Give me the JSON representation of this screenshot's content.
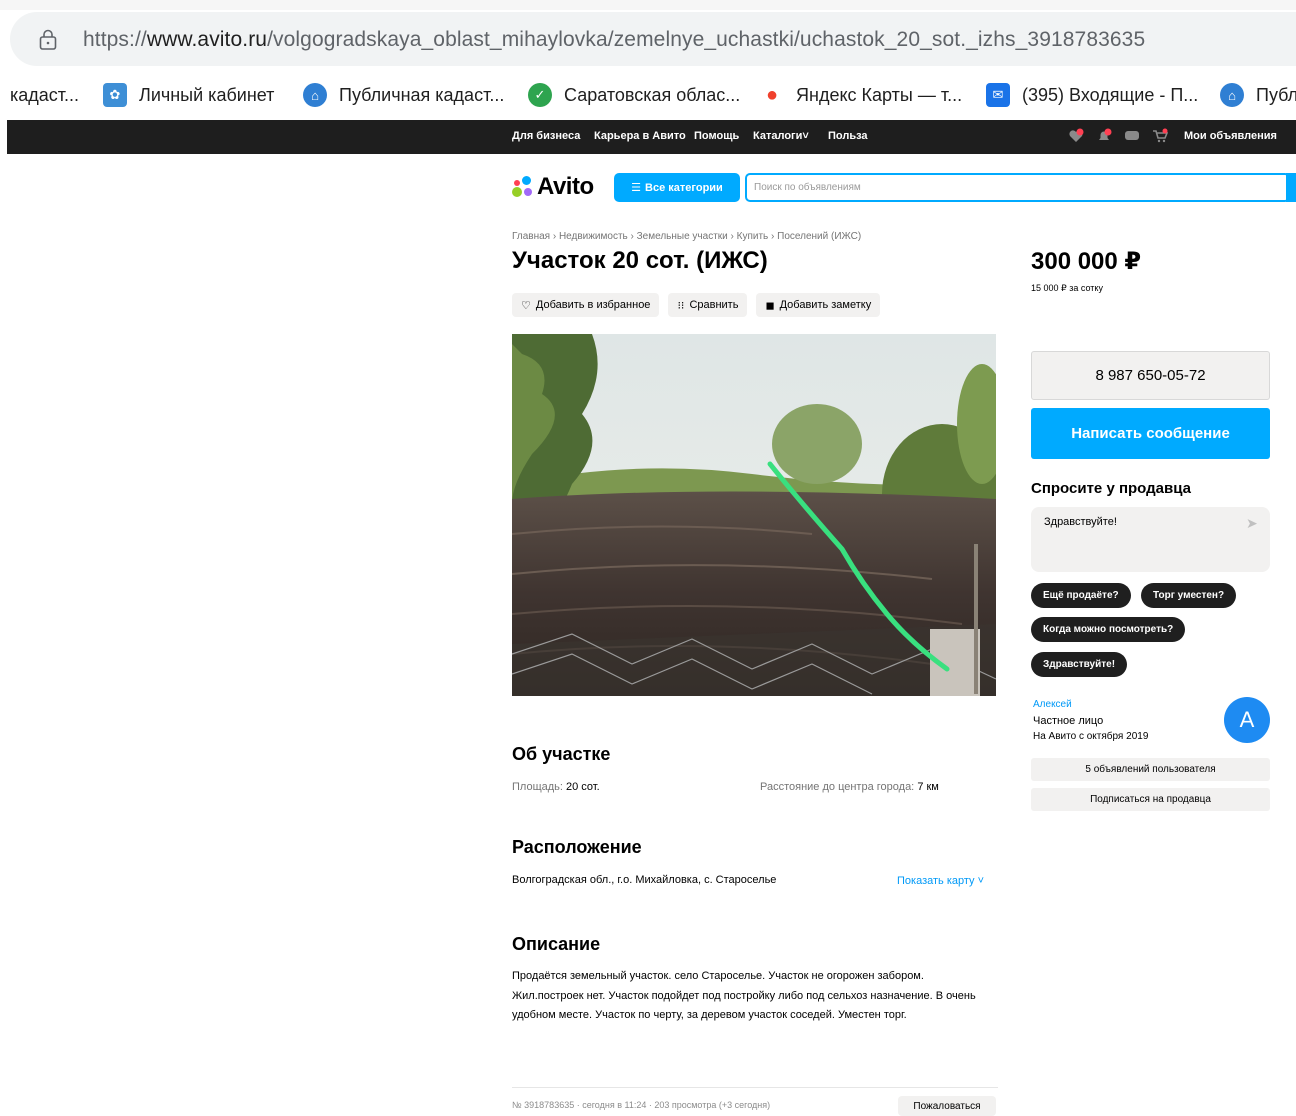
{
  "browser": {
    "url_prefix": "https://",
    "url_domain": "www.avito.ru",
    "url_path": "/volgogradskaya_oblast_mihaylovka/zemelnye_uchastki/uchastok_20_sot._izhs_3918783635",
    "bookmarks": [
      {
        "label": "кадаст...",
        "icon": "none"
      },
      {
        "label": "Личный кабинет",
        "icon": "rosreestr-icon"
      },
      {
        "label": "Публичная кадаст...",
        "icon": "house-icon"
      },
      {
        "label": "Саратовская облас...",
        "icon": "check-icon"
      },
      {
        "label": "Яндекс Карты — т...",
        "icon": "map-pin-icon"
      },
      {
        "label": "(395) Входящие - П...",
        "icon": "mail-icon"
      },
      {
        "label": "Публ",
        "icon": "house-icon"
      }
    ]
  },
  "topnav": {
    "items": [
      "Для бизнеса",
      "Карьера в Авито",
      "Помощь",
      "Каталоги",
      "Польза"
    ],
    "my_ads": "Мои объявления"
  },
  "header": {
    "logo": "Avito",
    "categories_button": "Все категории",
    "search_placeholder": "Поиск по объявлениям"
  },
  "listing": {
    "breadcrumbs": "Главная  ›  Недвижимость  ›  Земельные участки  ›  Купить  ›  Поселений (ИЖС)",
    "title": "Участок 20 сот. (ИЖС)",
    "actions": {
      "favorite": "Добавить в избранное",
      "compare": "Сравнить",
      "note": "Добавить заметку"
    },
    "about_title": "Об участке",
    "area_label": "Площадь:",
    "area_value": "20 сот.",
    "distance_label": "Расстояние до центра города:",
    "distance_value": "7 км",
    "location_title": "Расположение",
    "address": "Волгоградская обл., г.о. Михайловка, с. Староселье",
    "show_map": "Показать карту ˅",
    "description_title": "Описание",
    "description": "Продаётся земельный участок. село Староселье. Участок не огорожен забором. Жил.построек нет. Участок подойдет под постройку либо под сельхоз назначение. В очень удобном месте. Участок по черту, за деревом участок соседей. Уместен торг.",
    "meta": "№ 3918783635 · сегодня в 11:24 · 203 просмотра (+3 сегодня)",
    "complain": "Пожаловаться"
  },
  "sidebar": {
    "price": "300 000 ₽",
    "price_per_unit": "15 000 ₽ за сотку",
    "phone": "8 987 650-05-72",
    "message_button": "Написать сообщение",
    "ask_title": "Спросите у продавца",
    "ask_text": "Здравствуйте!",
    "quick_replies": [
      "Ещё продаёте?",
      "Торг уместен?",
      "Когда можно посмотреть?",
      "Здравствуйте!"
    ],
    "seller_name": "Алексей",
    "seller_type": "Частное лицо",
    "seller_since": "На Авито с октября 2019",
    "avatar_letter": "A",
    "user_ads": "5 объявлений пользователя",
    "subscribe": "Подписаться на продавца"
  },
  "colors": {
    "accent": "#00aaff",
    "dark": "#1e1e1e",
    "link": "#0099f7"
  }
}
